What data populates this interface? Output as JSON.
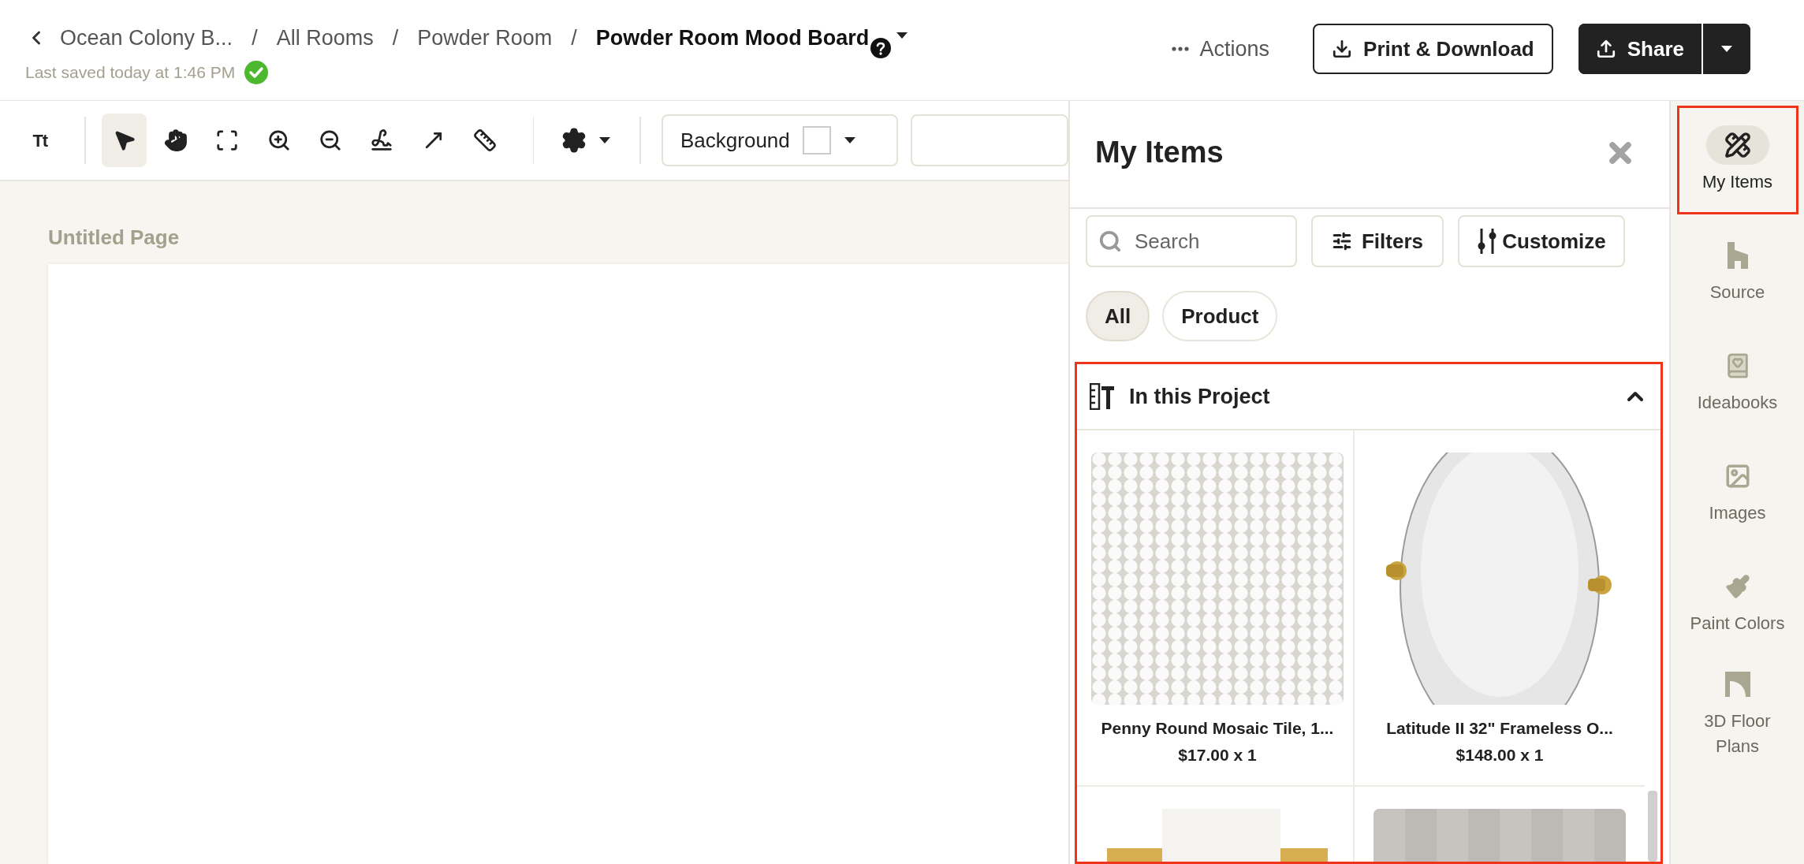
{
  "header": {
    "breadcrumbs": [
      {
        "label": "Ocean Colony B..."
      },
      {
        "label": "All Rooms"
      },
      {
        "label": "Powder Room"
      }
    ],
    "separator": "/",
    "board_title": "Powder Room Mood Board",
    "last_saved": "Last saved today at 1:46 PM",
    "actions": "Actions",
    "print": "Print & Download",
    "share": "Share"
  },
  "toolbar": {
    "tools": [
      {
        "kind": "text",
        "label": "Tt",
        "selected": false
      },
      {
        "kind": "select",
        "selected": true
      },
      {
        "kind": "pan",
        "selected": false
      },
      {
        "kind": "fit",
        "selected": false
      },
      {
        "kind": "zoom_in",
        "selected": false
      },
      {
        "kind": "zoom_out",
        "selected": false
      },
      {
        "kind": "draw",
        "selected": false
      },
      {
        "kind": "arrow",
        "selected": false
      },
      {
        "kind": "ruler",
        "selected": false
      }
    ],
    "background": "Background"
  },
  "canvas": {
    "page_title": "Untitled Page"
  },
  "panel": {
    "title": "My Items",
    "search": {
      "placeholder": "Search"
    },
    "filters": "Filters",
    "customize": "Customize",
    "chips": [
      {
        "label": "All",
        "selected": true
      },
      {
        "label": "Product",
        "selected": false
      }
    ],
    "section": {
      "title": "In this Project",
      "expanded": true,
      "highlighted": true,
      "items": [
        {
          "kind": "tile",
          "name": "Penny Round Mosaic Tile, 1...",
          "price": "$17.00 x 1"
        },
        {
          "kind": "mirror",
          "name": "Latitude II 32\" Frameless O...",
          "price": "$148.00 x 1"
        },
        {
          "kind": "sconce"
        },
        {
          "kind": "wall"
        }
      ]
    }
  },
  "sidebar": [
    {
      "kind": "my_items",
      "label": "My Items",
      "selected": true,
      "highlighted": true
    },
    {
      "kind": "source",
      "label": "Source",
      "selected": false,
      "highlighted": false
    },
    {
      "kind": "ideabooks",
      "label": "Ideabooks",
      "selected": false,
      "highlighted": false
    },
    {
      "kind": "images",
      "label": "Images",
      "selected": false,
      "highlighted": false
    },
    {
      "kind": "paint",
      "label": "Paint Colors",
      "selected": false,
      "highlighted": false
    },
    {
      "kind": "floor_plans",
      "label": "3D Floor Plans",
      "selected": false,
      "highlighted": false
    }
  ]
}
